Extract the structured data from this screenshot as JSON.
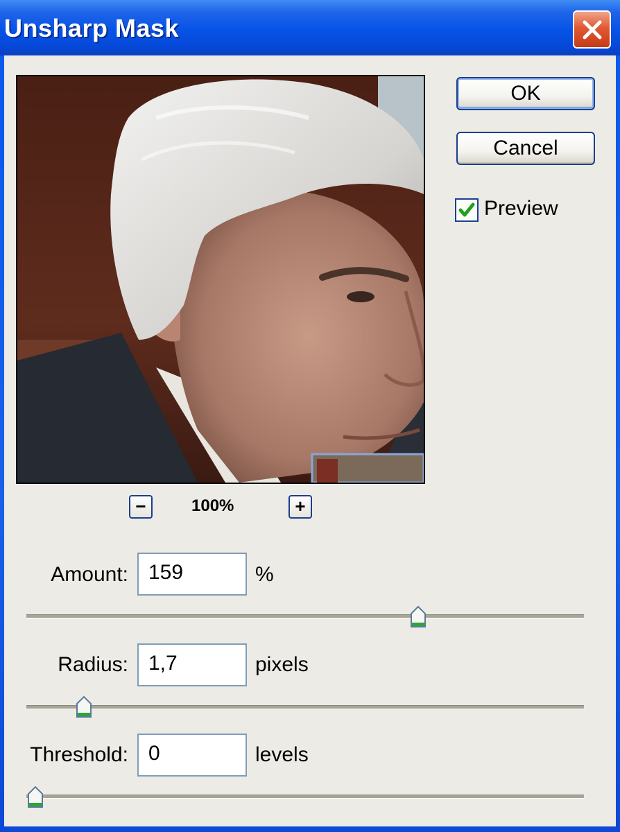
{
  "window": {
    "title": "Unsharp Mask"
  },
  "preview": {
    "zoom_level": "100%",
    "zoom_out_symbol": "−",
    "zoom_in_symbol": "+"
  },
  "buttons": {
    "ok_label": "OK",
    "cancel_label": "Cancel"
  },
  "preview_checkbox": {
    "label": "Preview",
    "checked": true
  },
  "fields": {
    "amount": {
      "label": "Amount:",
      "value": "159",
      "unit": "%",
      "slider_fraction": 0.71
    },
    "radius": {
      "label": "Radius:",
      "value": "1,7",
      "unit": "pixels",
      "slider_fraction": 0.09
    },
    "threshold": {
      "label": "Threshold:",
      "value": "0",
      "unit": "levels",
      "slider_fraction": 0.0
    }
  },
  "icons": {
    "close": "close-icon",
    "check": "checkmark-icon",
    "slider_thumb": "slider-thumb-icon"
  },
  "colors": {
    "title_bar": "#0653e6",
    "close_button": "#e05a34",
    "dialog_bg": "#ecebe5",
    "check": "#1fa01f"
  }
}
